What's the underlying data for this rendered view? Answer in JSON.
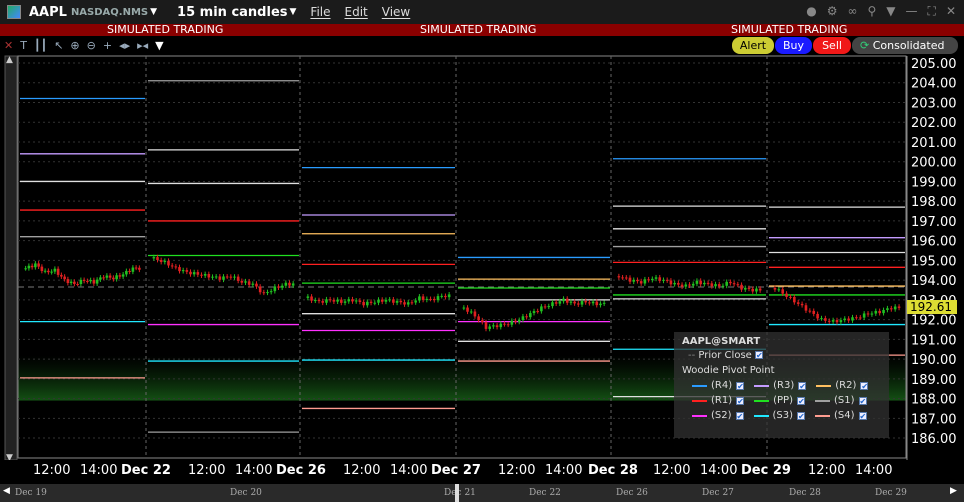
{
  "header": {
    "symbol": "AAPL",
    "exchange": "NASDAQ.NMS",
    "period": "15 min candles",
    "menus": [
      "File",
      "Edit",
      "View"
    ]
  },
  "sim_banner": "SIMULATED TRADING",
  "buttons": {
    "alert": "Alert",
    "buy": "Buy",
    "sell": "Sell",
    "consolidated": "Consolidated"
  },
  "colors": {
    "R4": "#2a9cff",
    "R3": "#c49cff",
    "R2": "#ffc060",
    "R1": "#ff2020",
    "PP": "#20e020",
    "S1": "#a0a0a0",
    "S2": "#ff30ff",
    "S3": "#20e8ff",
    "S4": "#ff9c90",
    "up": "#20c020",
    "down": "#e02020",
    "accent": "#dddd33"
  },
  "chart_data": {
    "type": "candlestick",
    "y_ticks": [
      "205.00",
      "204.00",
      "203.00",
      "202.00",
      "201.00",
      "200.00",
      "199.00",
      "198.00",
      "197.00",
      "196.00",
      "195.00",
      "194.00",
      "193.00",
      "192.00",
      "191.00",
      "190.00",
      "189.00",
      "188.00",
      "187.00",
      "186.00"
    ],
    "ylim": [
      186,
      205
    ],
    "last_price": "192.61",
    "prior_close": 193.65,
    "x_labels": [
      "12:00",
      "14:00",
      "Dec 22",
      "12:00",
      "14:00",
      "Dec 26",
      "12:00",
      "14:00",
      "Dec 27",
      "12:00",
      "14:00",
      "Dec 28",
      "12:00",
      "14:00",
      "Dec 29",
      "12:00",
      "14:00"
    ],
    "sessions": [
      {
        "closes": [
          194.6,
          194.8,
          194.4,
          194.5,
          194.0,
          193.8,
          194.0,
          193.9,
          194.2,
          194.1,
          194.3,
          194.6
        ],
        "levels": [
          [
            203.2,
            "#2a9cff"
          ],
          [
            200.4,
            "#c49cff"
          ],
          [
            199.0,
            "#e0e0e0"
          ],
          [
            197.55,
            "#ff2020"
          ],
          [
            196.2,
            "#a0a0a0"
          ],
          [
            191.9,
            "#20e8ff"
          ],
          [
            189.05,
            "#ff9c90"
          ]
        ]
      },
      {
        "closes": [
          195.1,
          194.9,
          194.6,
          194.4,
          194.3,
          194.2,
          194.1,
          194.2,
          193.9,
          193.8,
          193.3,
          193.6,
          193.8
        ],
        "levels": [
          [
            204.1,
            "#a0a0a0"
          ],
          [
            200.6,
            "#e0e0e0"
          ],
          [
            198.9,
            "#e0e0e0"
          ],
          [
            197.0,
            "#ff2020"
          ],
          [
            195.25,
            "#20e020"
          ],
          [
            191.75,
            "#ff30ff"
          ],
          [
            189.9,
            "#20e8ff"
          ],
          [
            186.3,
            "#a0a0a0"
          ]
        ]
      },
      {
        "closes": [
          193.1,
          192.9,
          193.0,
          192.9,
          193.0,
          192.8,
          192.9,
          193.0,
          192.9,
          192.8,
          193.1,
          193.0,
          193.2
        ],
        "levels": [
          [
            199.7,
            "#2a9cff"
          ],
          [
            197.3,
            "#c49cff"
          ],
          [
            196.35,
            "#ffc060"
          ],
          [
            194.8,
            "#ff2020"
          ],
          [
            193.85,
            "#20e020"
          ],
          [
            192.3,
            "#e0e0e0"
          ],
          [
            191.45,
            "#ff30ff"
          ],
          [
            189.95,
            "#20e8ff"
          ],
          [
            187.5,
            "#ff9c90"
          ]
        ]
      },
      {
        "closes": [
          192.6,
          192.2,
          191.6,
          191.7,
          191.8,
          192.0,
          192.3,
          192.6,
          192.8,
          193.0,
          192.8,
          192.9,
          192.8
        ],
        "levels": [
          [
            195.15,
            "#2a9cff"
          ],
          [
            194.05,
            "#ffc060"
          ],
          [
            193.6,
            "#20e020"
          ],
          [
            193.0,
            "#e0e0e0"
          ],
          [
            191.9,
            "#ff30ff"
          ],
          [
            190.9,
            "#e0e0e0"
          ],
          [
            189.9,
            "#ff9c90"
          ]
        ]
      },
      {
        "closes": [
          194.2,
          194.0,
          193.9,
          194.1,
          194.0,
          193.8,
          193.7,
          193.9,
          193.8,
          193.7,
          193.9,
          193.6,
          193.5
        ],
        "levels": [
          [
            200.15,
            "#2a9cff"
          ],
          [
            197.75,
            "#e0e0e0"
          ],
          [
            196.6,
            "#e0e0e0"
          ],
          [
            195.7,
            "#a0a0a0"
          ],
          [
            194.9,
            "#ff2020"
          ],
          [
            193.25,
            "#20e020"
          ],
          [
            193.05,
            "#e0e0e0"
          ],
          [
            190.5,
            "#20e8ff"
          ],
          [
            188.1,
            "#e0e0e0"
          ]
        ]
      },
      {
        "closes": [
          193.6,
          193.2,
          192.8,
          192.4,
          192.0,
          191.9,
          192.0,
          192.1,
          192.3,
          192.4,
          192.6
        ],
        "levels": [
          [
            197.7,
            "#e0e0e0"
          ],
          [
            196.15,
            "#c49cff"
          ],
          [
            195.4,
            "#e0e0e0"
          ],
          [
            194.65,
            "#ff2020"
          ],
          [
            193.7,
            "#ffc060"
          ],
          [
            193.25,
            "#20e020"
          ],
          [
            191.75,
            "#20e8ff"
          ],
          [
            190.2,
            "#ff9c90"
          ]
        ]
      }
    ]
  },
  "legend": {
    "title": "AAPL@SMART",
    "prior_close": "Prior Close",
    "study": "Woodie Pivot Point",
    "items": [
      {
        "label": "(R4)",
        "key": "R4"
      },
      {
        "label": "(R3)",
        "key": "R3"
      },
      {
        "label": "(R2)",
        "key": "R2"
      },
      {
        "label": "(R1)",
        "key": "R1"
      },
      {
        "label": "(PP)",
        "key": "PP"
      },
      {
        "label": "(S1)",
        "key": "S1"
      },
      {
        "label": "(S2)",
        "key": "S2"
      },
      {
        "label": "(S3)",
        "key": "S3"
      },
      {
        "label": "(S4)",
        "key": "S4"
      }
    ]
  },
  "navigator": [
    "Dec 19",
    "Dec 20",
    "Dec 21",
    "Dec 22",
    "Dec 26",
    "Dec 27",
    "Dec 28",
    "Dec 29"
  ]
}
